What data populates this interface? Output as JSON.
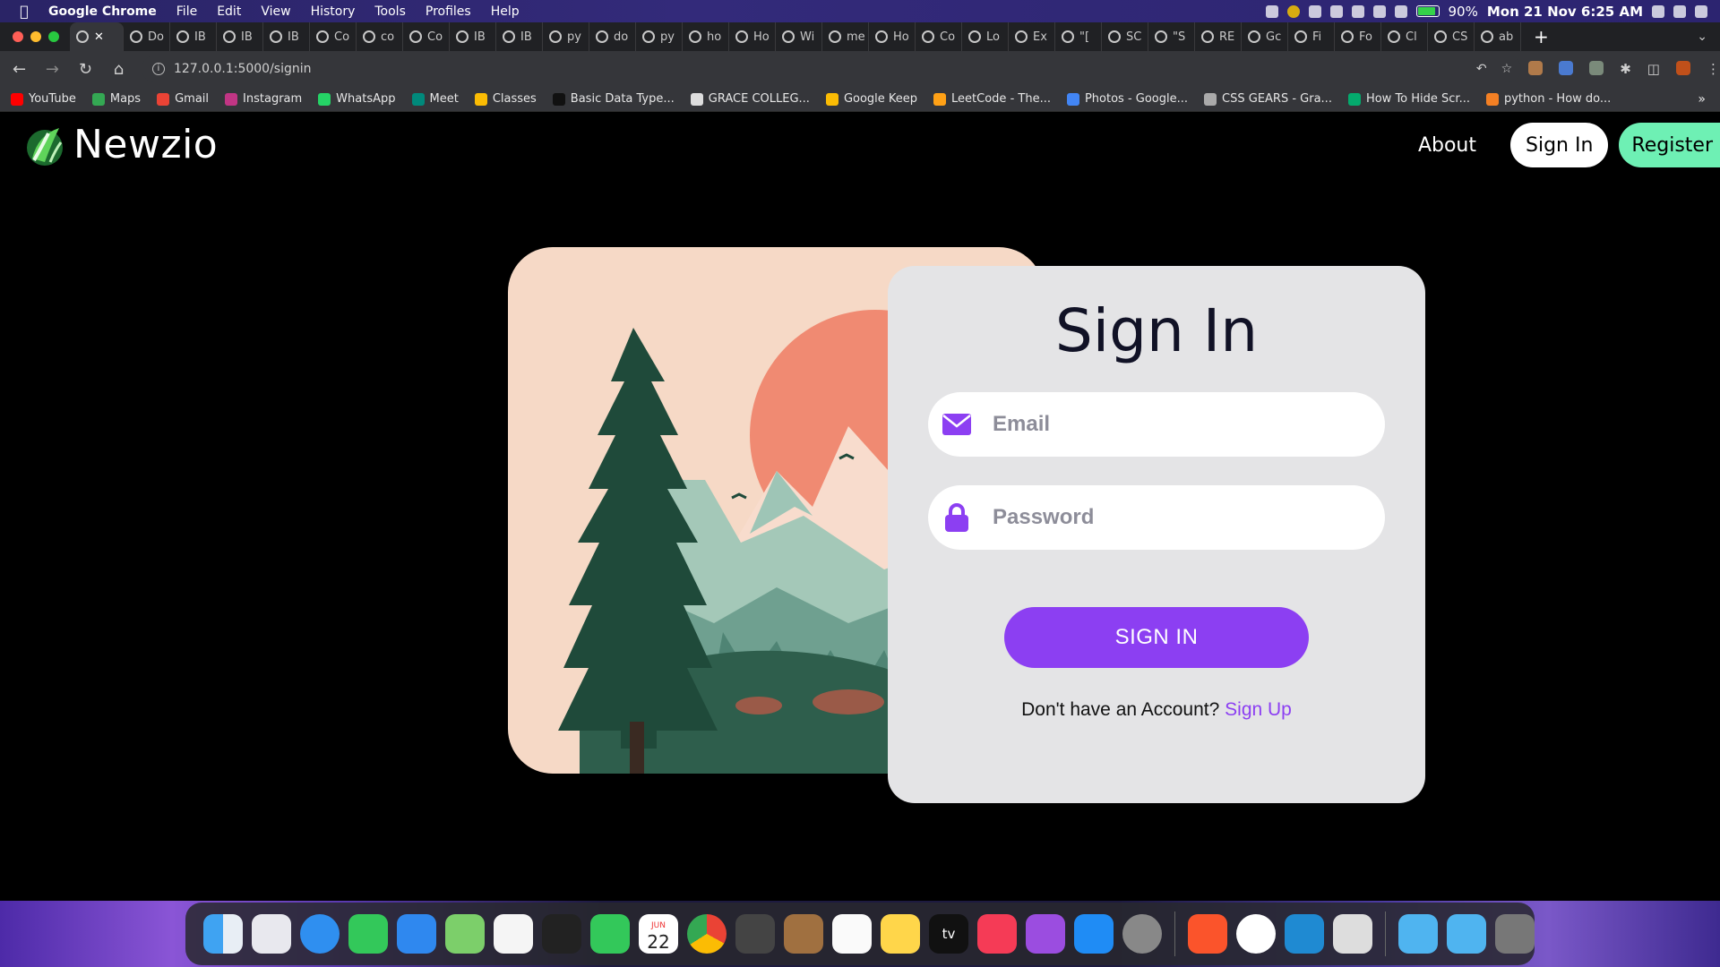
{
  "menubar": {
    "app_name": "Google Chrome",
    "menus": [
      "File",
      "Edit",
      "View",
      "History",
      "Tools",
      "Profiles",
      "Help"
    ],
    "battery_percent": "90%",
    "battery_level": 0.9,
    "clock": "Mon 21 Nov  6:25 AM"
  },
  "tabs": [
    {
      "label": "Do",
      "active": false
    },
    {
      "label": "IB",
      "active": false
    },
    {
      "label": "IB",
      "active": false
    },
    {
      "label": "IB",
      "active": false
    },
    {
      "label": "Co",
      "active": false
    },
    {
      "label": "co",
      "active": false
    },
    {
      "label": "Co",
      "active": false
    },
    {
      "label": "IB",
      "active": false
    },
    {
      "label": "IB",
      "active": false
    },
    {
      "label": "py",
      "active": false
    },
    {
      "label": "do",
      "active": false
    },
    {
      "label": "py",
      "active": false
    },
    {
      "label": "ho",
      "active": false
    },
    {
      "label": "Ho",
      "active": false
    },
    {
      "label": "Wi",
      "active": false
    },
    {
      "label": "me",
      "active": false
    },
    {
      "label": "Ho",
      "active": false
    },
    {
      "label": "Co",
      "active": false
    },
    {
      "label": "Lo",
      "active": false
    },
    {
      "label": "Ex",
      "active": false
    },
    {
      "label": "\"[",
      "active": false
    },
    {
      "label": "SC",
      "active": false
    },
    {
      "label": "\"S",
      "active": false
    },
    {
      "label": "RE",
      "active": false
    },
    {
      "label": "Gc",
      "active": false
    },
    {
      "label": "Fi",
      "active": false
    },
    {
      "label": "Fo",
      "active": false
    },
    {
      "label": "Cl",
      "active": false
    },
    {
      "label": "CS",
      "active": false
    },
    {
      "label": "ab",
      "active": false
    }
  ],
  "toolbar": {
    "url": "127.0.0.1:5000/signin"
  },
  "bookmarks": [
    {
      "label": "YouTube",
      "color": "#ff0000"
    },
    {
      "label": "Maps",
      "color": "#34a853"
    },
    {
      "label": "Gmail",
      "color": "#ea4335"
    },
    {
      "label": "Instagram",
      "color": "#c13584"
    },
    {
      "label": "WhatsApp",
      "color": "#25d366"
    },
    {
      "label": "Meet",
      "color": "#00897b"
    },
    {
      "label": "Classes",
      "color": "#fbbc04"
    },
    {
      "label": "Basic Data Type...",
      "color": "#111111"
    },
    {
      "label": "GRACE COLLEG...",
      "color": "#dddddd"
    },
    {
      "label": "Google Keep",
      "color": "#fbbc04"
    },
    {
      "label": "LeetCode - The...",
      "color": "#ffa116"
    },
    {
      "label": "Photos - Google...",
      "color": "#4285f4"
    },
    {
      "label": "CSS GEARS - Gra...",
      "color": "#aaaaaa"
    },
    {
      "label": "How To Hide Scr...",
      "color": "#04aa6d"
    },
    {
      "label": "python - How do...",
      "color": "#f48024"
    }
  ],
  "site": {
    "brand": "Newzio",
    "nav": {
      "about": "About",
      "signin": "Sign In",
      "register": "Register"
    }
  },
  "signin_card": {
    "title": "Sign In",
    "email_placeholder": "Email",
    "password_placeholder": "Password",
    "submit": "SIGN IN",
    "prompt": "Don't have an Account?",
    "signup_link": "Sign Up"
  },
  "colors": {
    "accent": "#8c3ff2",
    "register_bg": "#6ef0b4",
    "card_bg": "#e4e4e6",
    "illustration_bg": "#f6d9c6"
  },
  "dock": {
    "calendar_day": "22",
    "calendar_month": "JUN",
    "tv_label": "tv"
  }
}
